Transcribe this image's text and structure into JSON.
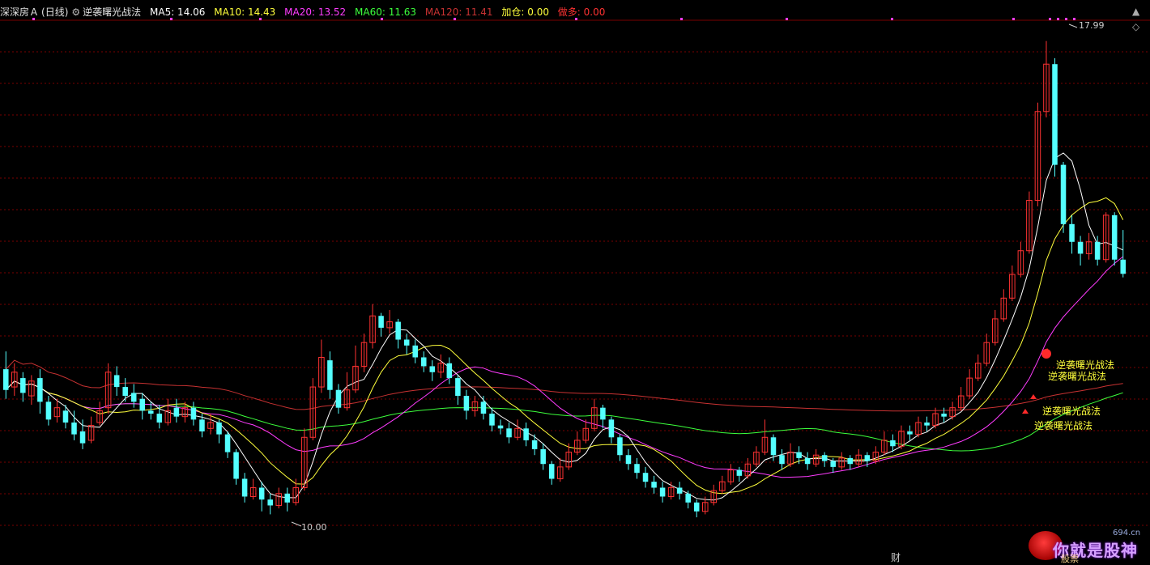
{
  "header": {
    "stock_name": "深深房Ａ",
    "period": "(日线)",
    "indicator_name": "逆袭曙光战法",
    "ma5": "MA5: 14.06",
    "ma10": "MA10: 14.43",
    "ma20": "MA20: 13.52",
    "ma60": "MA60: 11.63",
    "ma120": "MA120: 11.41",
    "jiacang": "加仓: 0.00",
    "zuoduo": "做多: 0.00"
  },
  "colors": {
    "background": "#000000",
    "up_candle": "#ff3232",
    "down_candle": "#54ffff",
    "ma5": "#ffffff",
    "ma10": "#ffff3c",
    "ma20": "#ff3cff",
    "ma60": "#3cff3c",
    "ma120": "#c83232",
    "grid": "#7a0000",
    "signal_text": "#ffff3c"
  },
  "annotations": {
    "high_price": "17.99",
    "low_price": "10.00",
    "signal_label": "逆袭曙光战法",
    "footer_cai": "财",
    "watermark_text": "你就是股神",
    "watermark_domain": "694.cn",
    "watermark_sub": "股票"
  },
  "chart_data": {
    "type": "candlestick",
    "y_range": [
      9.5,
      18.3
    ],
    "highest": 17.99,
    "lowest": 10.0,
    "candles": [
      [
        12.45,
        12.1,
        12.75,
        11.95
      ],
      [
        12.15,
        12.4,
        12.55,
        12.0
      ],
      [
        12.3,
        12.05,
        12.4,
        11.9
      ],
      [
        12.0,
        12.25,
        12.35,
        11.85
      ],
      [
        12.3,
        11.9,
        12.45,
        11.7
      ],
      [
        11.9,
        11.6,
        12.0,
        11.5
      ],
      [
        11.65,
        11.8,
        11.95,
        11.55
      ],
      [
        11.75,
        11.55,
        11.85,
        11.45
      ],
      [
        11.55,
        11.35,
        11.75,
        11.25
      ],
      [
        11.4,
        11.2,
        11.6,
        11.1
      ],
      [
        11.25,
        11.5,
        11.65,
        11.2
      ],
      [
        11.55,
        11.75,
        11.9,
        11.5
      ],
      [
        11.8,
        12.4,
        12.55,
        11.7
      ],
      [
        12.35,
        12.15,
        12.5,
        12.0
      ],
      [
        12.15,
        12.0,
        12.3,
        11.9
      ],
      [
        12.05,
        11.9,
        12.2,
        11.8
      ],
      [
        11.95,
        11.75,
        12.05,
        11.6
      ],
      [
        11.75,
        11.7,
        11.9,
        11.6
      ],
      [
        11.7,
        11.55,
        11.85,
        11.45
      ],
      [
        11.55,
        11.75,
        11.95,
        11.5
      ],
      [
        11.8,
        11.65,
        11.95,
        11.55
      ],
      [
        11.65,
        11.8,
        11.9,
        11.55
      ],
      [
        11.8,
        11.6,
        11.9,
        11.5
      ],
      [
        11.6,
        11.4,
        11.7,
        11.3
      ],
      [
        11.45,
        11.55,
        11.7,
        11.35
      ],
      [
        11.55,
        11.35,
        11.6,
        11.2
      ],
      [
        11.35,
        11.05,
        11.4,
        10.95
      ],
      [
        11.05,
        10.6,
        11.1,
        10.5
      ],
      [
        10.6,
        10.3,
        10.7,
        10.2
      ],
      [
        10.3,
        10.45,
        10.6,
        10.25
      ],
      [
        10.45,
        10.25,
        10.55,
        10.05
      ],
      [
        10.25,
        10.15,
        10.35,
        10.0
      ],
      [
        10.15,
        10.35,
        10.45,
        10.1
      ],
      [
        10.35,
        10.2,
        10.45,
        10.05
      ],
      [
        10.2,
        10.45,
        10.6,
        10.15
      ],
      [
        10.45,
        11.3,
        11.45,
        10.4
      ],
      [
        11.3,
        12.15,
        12.3,
        11.25
      ],
      [
        12.15,
        12.65,
        12.95,
        12.05
      ],
      [
        12.6,
        12.1,
        12.75,
        11.95
      ],
      [
        12.1,
        11.8,
        12.2,
        11.7
      ],
      [
        11.8,
        12.1,
        12.4,
        11.75
      ],
      [
        12.1,
        12.5,
        12.85,
        12.05
      ],
      [
        12.5,
        12.9,
        13.05,
        12.4
      ],
      [
        12.9,
        13.35,
        13.55,
        12.8
      ],
      [
        13.35,
        13.15,
        13.4,
        13.0
      ],
      [
        13.15,
        13.25,
        13.45,
        13.05
      ],
      [
        13.25,
        12.95,
        13.3,
        12.8
      ],
      [
        12.95,
        12.85,
        13.05,
        12.7
      ],
      [
        12.85,
        12.65,
        12.95,
        12.55
      ],
      [
        12.65,
        12.5,
        12.75,
        12.4
      ],
      [
        12.5,
        12.4,
        12.6,
        12.25
      ],
      [
        12.4,
        12.55,
        12.7,
        12.3
      ],
      [
        12.55,
        12.3,
        12.65,
        12.2
      ],
      [
        12.3,
        12.0,
        12.35,
        11.85
      ],
      [
        12.0,
        11.75,
        12.1,
        11.6
      ],
      [
        11.75,
        11.9,
        12.0,
        11.65
      ],
      [
        11.9,
        11.7,
        12.0,
        11.6
      ],
      [
        11.7,
        11.5,
        11.8,
        11.4
      ],
      [
        11.5,
        11.45,
        11.6,
        11.35
      ],
      [
        11.45,
        11.3,
        11.55,
        11.2
      ],
      [
        11.3,
        11.45,
        11.6,
        11.25
      ],
      [
        11.45,
        11.25,
        11.55,
        11.15
      ],
      [
        11.25,
        11.1,
        11.35,
        11.0
      ],
      [
        11.1,
        10.85,
        11.2,
        10.75
      ],
      [
        10.85,
        10.6,
        10.9,
        10.5
      ],
      [
        10.6,
        10.8,
        10.95,
        10.55
      ],
      [
        10.8,
        11.05,
        11.2,
        10.75
      ],
      [
        11.05,
        11.25,
        11.4,
        11.0
      ],
      [
        11.25,
        11.45,
        11.6,
        11.2
      ],
      [
        11.45,
        11.8,
        11.95,
        11.4
      ],
      [
        11.8,
        11.6,
        11.85,
        11.45
      ],
      [
        11.6,
        11.3,
        11.65,
        11.2
      ],
      [
        11.3,
        11.0,
        11.35,
        10.9
      ],
      [
        11.0,
        10.85,
        11.1,
        10.75
      ],
      [
        10.85,
        10.7,
        10.95,
        10.6
      ],
      [
        10.7,
        10.55,
        10.8,
        10.45
      ],
      [
        10.55,
        10.45,
        10.65,
        10.35
      ],
      [
        10.45,
        10.3,
        10.55,
        10.2
      ],
      [
        10.3,
        10.45,
        10.55,
        10.25
      ],
      [
        10.45,
        10.35,
        10.55,
        10.25
      ],
      [
        10.35,
        10.2,
        10.4,
        10.1
      ],
      [
        10.2,
        10.05,
        10.25,
        9.95
      ],
      [
        10.05,
        10.2,
        10.3,
        10.0
      ],
      [
        10.2,
        10.4,
        10.5,
        10.15
      ],
      [
        10.4,
        10.55,
        10.65,
        10.35
      ],
      [
        10.55,
        10.75,
        10.85,
        10.5
      ],
      [
        10.75,
        10.65,
        10.8,
        10.55
      ],
      [
        10.65,
        10.85,
        10.95,
        10.6
      ],
      [
        10.85,
        11.05,
        11.15,
        10.8
      ],
      [
        11.05,
        11.3,
        11.6,
        11.0
      ],
      [
        11.3,
        11.0,
        11.35,
        10.9
      ],
      [
        11.0,
        10.85,
        11.1,
        10.75
      ],
      [
        10.85,
        11.05,
        11.2,
        10.8
      ],
      [
        11.05,
        10.95,
        11.15,
        10.85
      ],
      [
        10.95,
        10.85,
        11.05,
        10.75
      ],
      [
        10.85,
        11.0,
        11.1,
        10.8
      ],
      [
        11.0,
        10.9,
        11.05,
        10.8
      ],
      [
        10.9,
        10.8,
        10.95,
        10.7
      ],
      [
        10.8,
        10.95,
        11.05,
        10.75
      ],
      [
        10.95,
        10.85,
        11.0,
        10.75
      ],
      [
        10.85,
        11.0,
        11.1,
        10.8
      ],
      [
        11.0,
        10.9,
        11.05,
        10.8
      ],
      [
        10.9,
        11.05,
        11.15,
        10.85
      ],
      [
        11.05,
        11.25,
        11.4,
        11.0
      ],
      [
        11.25,
        11.15,
        11.35,
        11.05
      ],
      [
        11.15,
        11.4,
        11.5,
        11.1
      ],
      [
        11.4,
        11.35,
        11.5,
        11.25
      ],
      [
        11.35,
        11.55,
        11.65,
        11.3
      ],
      [
        11.55,
        11.5,
        11.65,
        11.4
      ],
      [
        11.5,
        11.7,
        11.8,
        11.45
      ],
      [
        11.7,
        11.65,
        11.8,
        11.55
      ],
      [
        11.65,
        11.8,
        11.9,
        11.6
      ],
      [
        11.8,
        12.0,
        12.15,
        11.75
      ],
      [
        12.0,
        12.3,
        12.45,
        11.95
      ],
      [
        12.3,
        12.55,
        12.7,
        12.25
      ],
      [
        12.55,
        12.9,
        13.05,
        12.5
      ],
      [
        12.9,
        13.3,
        13.45,
        12.85
      ],
      [
        13.3,
        13.65,
        13.8,
        13.25
      ],
      [
        13.65,
        14.05,
        14.2,
        13.6
      ],
      [
        14.05,
        14.45,
        14.6,
        14.0
      ],
      [
        14.45,
        15.3,
        15.45,
        14.4
      ],
      [
        15.3,
        16.8,
        16.95,
        15.2
      ],
      [
        16.8,
        17.6,
        17.99,
        16.7
      ],
      [
        17.6,
        15.9,
        17.7,
        15.7
      ],
      [
        15.9,
        14.9,
        15.95,
        14.75
      ],
      [
        14.9,
        14.6,
        15.05,
        14.4
      ],
      [
        14.6,
        14.4,
        14.7,
        14.2
      ],
      [
        14.4,
        14.6,
        14.75,
        14.3
      ],
      [
        14.6,
        14.3,
        14.7,
        14.2
      ],
      [
        14.3,
        15.05,
        15.1,
        14.25
      ],
      [
        15.05,
        14.3,
        15.1,
        14.2
      ],
      [
        14.3,
        14.06,
        14.8,
        14.0
      ]
    ]
  }
}
